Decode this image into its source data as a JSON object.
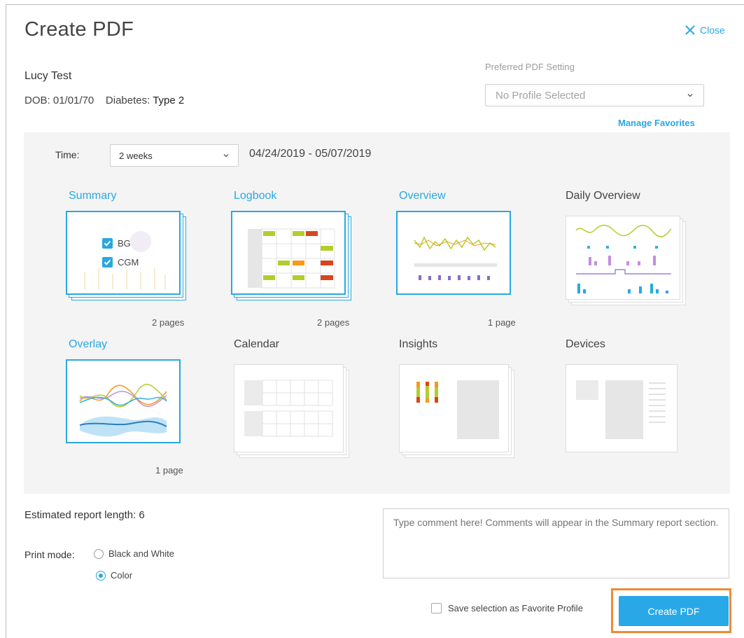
{
  "dialog": {
    "title": "Create PDF",
    "close_label": "Close"
  },
  "patient": {
    "name": "Lucy Test",
    "dob_label": "DOB:",
    "dob": "01/01/70",
    "diabetes_label": "Diabetes:",
    "diabetes_type": "Type 2"
  },
  "preferred": {
    "label": "Preferred PDF Setting",
    "value": "No Profile Selected",
    "manage_favorites": "Manage Favorites"
  },
  "time": {
    "label": "Time:",
    "value": "2 weeks",
    "date_range": "04/24/2019 - 05/07/2019"
  },
  "reports": [
    {
      "title": "Summary",
      "selected": true,
      "pages": "2 pages"
    },
    {
      "title": "Logbook",
      "selected": true,
      "pages": "2 pages"
    },
    {
      "title": "Overview",
      "selected": true,
      "pages": "1 page"
    },
    {
      "title": "Daily Overview",
      "selected": false,
      "pages": ""
    },
    {
      "title": "Overlay",
      "selected": true,
      "pages": "1 page"
    },
    {
      "title": "Calendar",
      "selected": false,
      "pages": ""
    },
    {
      "title": "Insights",
      "selected": false,
      "pages": ""
    },
    {
      "title": "Devices",
      "selected": false,
      "pages": ""
    }
  ],
  "summary_options": {
    "bg_label": "BG",
    "cgm_label": "CGM",
    "bg_checked": true,
    "cgm_checked": true
  },
  "estimate": {
    "label": "Estimated report length: 6"
  },
  "print_mode": {
    "label": "Print mode:",
    "options": [
      "Black and White",
      "Color"
    ],
    "selected": "Color"
  },
  "comment": {
    "placeholder": "Type comment here! Comments will appear in the Summary report section."
  },
  "save_favorite": {
    "label": "Save selection as Favorite Profile",
    "checked": false
  },
  "create_button": {
    "label": "Create PDF"
  },
  "colors": {
    "accent": "#29a8e0",
    "highlight": "#ef8b35",
    "panel_bg": "#f4f4f5"
  }
}
